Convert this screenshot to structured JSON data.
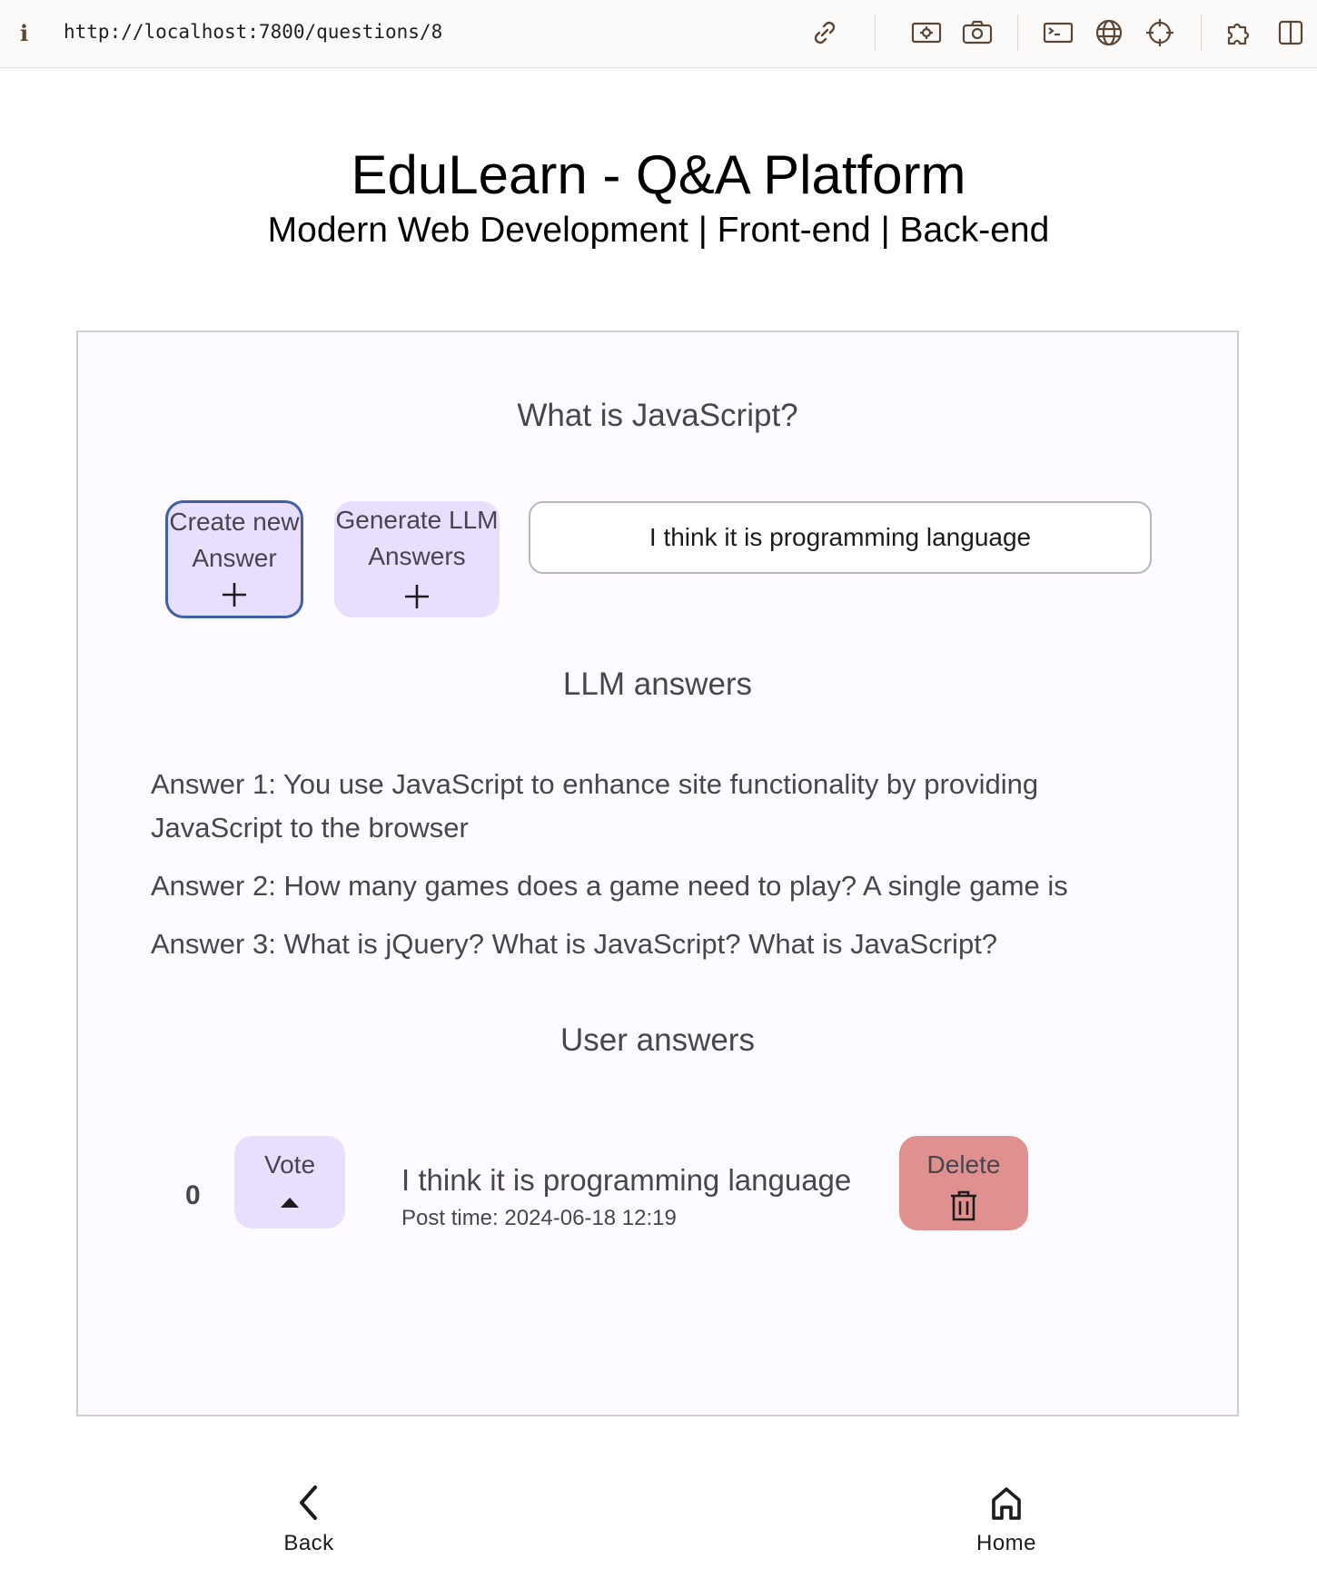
{
  "browser": {
    "url": "http://localhost:7800/questions/8",
    "icons": [
      "info-icon",
      "link-icon",
      "screenshot-icon",
      "camera-icon",
      "terminal-icon",
      "globe-icon",
      "crosshair-icon",
      "extension-icon",
      "sidebar-icon"
    ]
  },
  "header": {
    "title": "EduLearn - Q&A Platform",
    "subtitle": "Modern Web Development | Front-end | Back-end"
  },
  "question": {
    "title": "What is JavaScript?",
    "create_button_label": "Create new Answer",
    "generate_button_label": "Generate LLM Answers",
    "answer_input_value": "I think it is programming language"
  },
  "llm": {
    "heading": "LLM answers",
    "answers": [
      "Answer 1: You use JavaScript to enhance site functionality by providing JavaScript to the browser",
      "Answer 2: How many games does a game need to play? A single game is",
      "Answer 3: What is jQuery? What is JavaScript? What is JavaScript?"
    ]
  },
  "user": {
    "heading": "User answers",
    "answers": [
      {
        "votes": "0",
        "vote_label": "Vote",
        "text": "I think it is programming language",
        "post_time": "Post time: 2024-06-18 12:19",
        "delete_label": "Delete"
      }
    ]
  },
  "nav": {
    "back_label": "Back",
    "home_label": "Home"
  },
  "colors": {
    "button_purple": "#e8defe",
    "delete_red": "#e0918f",
    "focus_outline": "#3f5faa",
    "text_muted": "#49454f"
  }
}
